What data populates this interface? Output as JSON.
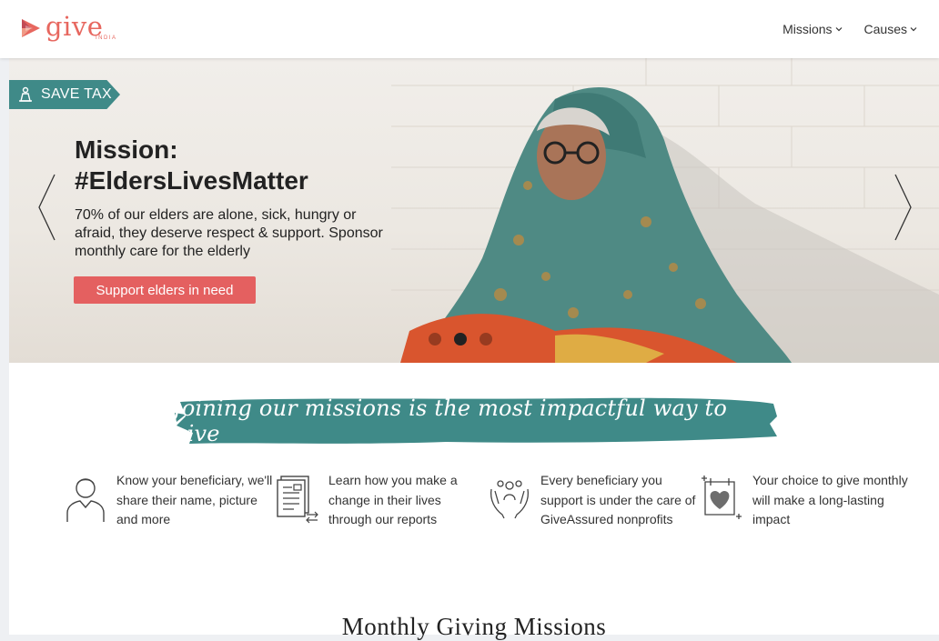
{
  "brand": {
    "name": "give",
    "sub": "INDIA",
    "color": "#e7675f"
  },
  "nav": {
    "items": [
      {
        "label": "Missions"
      },
      {
        "label": "Causes"
      }
    ]
  },
  "hero": {
    "badge": "SAVE TAX",
    "title_line1": "Mission:",
    "title_line2": "#EldersLivesMatter",
    "description": "70% of our elders are alone, sick, hungry or afraid, they deserve respect & support. Sponsor monthly care for the elderly",
    "cta": "Support elders in need",
    "slide_count": 3,
    "active_slide": 2
  },
  "banner": {
    "text": "Joining our missions is the most impactful way to give",
    "color": "#3f8a88"
  },
  "features": [
    {
      "icon": "person-icon",
      "text": "Know your beneficiary, we'll share their name, picture and more"
    },
    {
      "icon": "report-icon",
      "text": "Learn how you make a change in their lives through our reports"
    },
    {
      "icon": "hands-care-icon",
      "text": "Every beneficiary you support is under the care of GiveAssured nonprofits"
    },
    {
      "icon": "heart-calendar-icon",
      "text": "Your choice to give monthly will make a long-lasting impact"
    }
  ],
  "section": {
    "title": "Monthly Giving Missions"
  },
  "colors": {
    "accent": "#e46060",
    "teal": "#3f8a88"
  }
}
